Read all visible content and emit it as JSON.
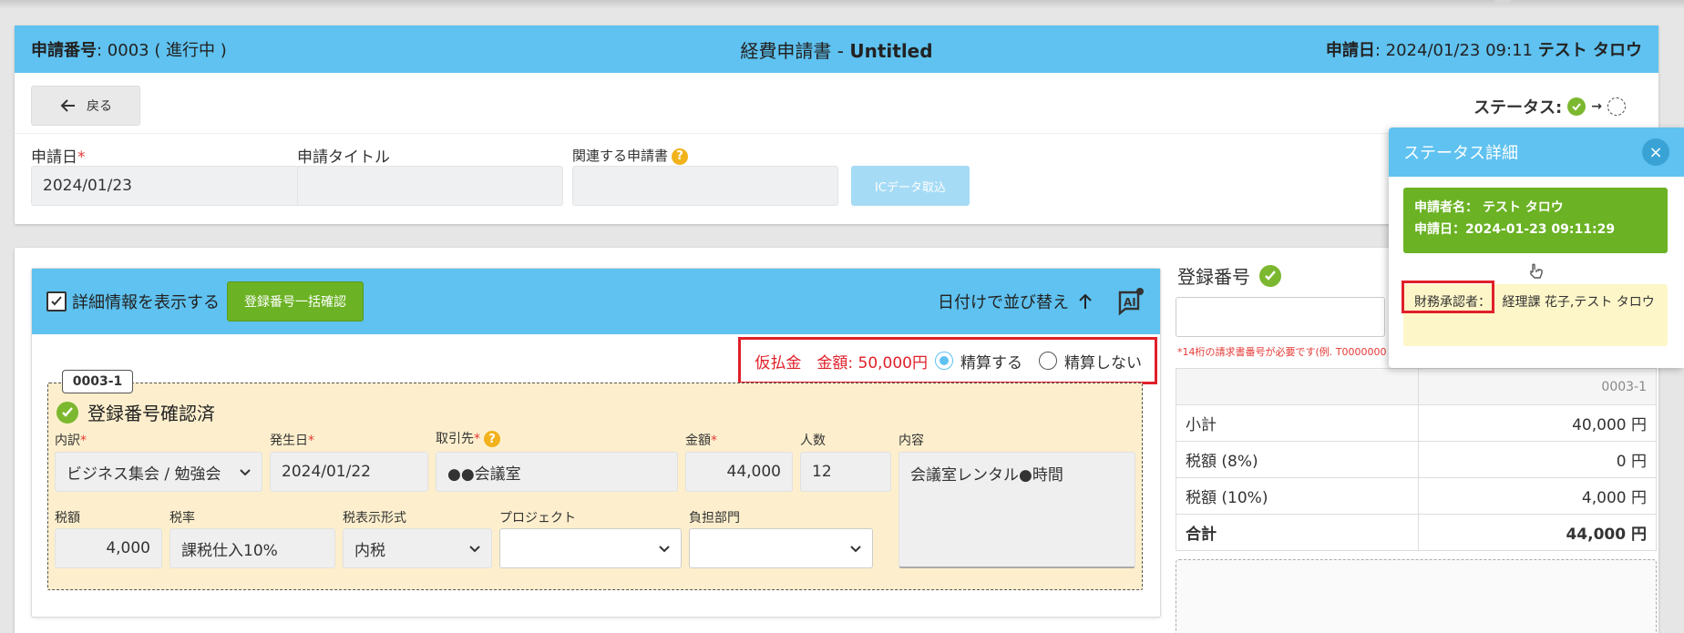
{
  "header": {
    "app_no_label": "申請番号",
    "app_no_value": ": 0003 ( 進行中 )",
    "title_prefix": "経費申請書 - ",
    "title_name": "Untitled",
    "date_label": "申請日",
    "date_value": ": 2024/01/23 09:11",
    "user": "テスト タロウ"
  },
  "toolbar": {
    "back_label": "戻る",
    "status_label": "ステータス:",
    "arrow": "→"
  },
  "form": {
    "date_label": "申請日",
    "required_mark": "*",
    "date_value": "2024/01/23",
    "title_label": "申請タイトル",
    "title_value": "",
    "related_label": "関連する申請書",
    "related_value": "",
    "ic_button": "ICデータ取込"
  },
  "list": {
    "detail_label": "詳細情報を表示する",
    "bulk_button": "登録番号一括確認",
    "sort_label": "日付けで並び替え",
    "advance_label": "仮払金　金額: 50,000円",
    "radio_settle": "精算する",
    "radio_nosettle": "精算しない"
  },
  "entry": {
    "tag": "0003-1",
    "confirmed": "登録番号確認済",
    "breakdown_label": "内訳",
    "breakdown_value": "ビジネス集会 / 勉強会",
    "date_label": "発生日",
    "date_value": "2024/01/22",
    "vendor_label": "取引先",
    "vendor_value": "●●会議室",
    "amount_label": "金額",
    "amount_value": "44,000",
    "people_label": "人数",
    "people_value": "12",
    "content_label": "内容",
    "content_value": "会議室レンタル●時間",
    "tax_label": "税額",
    "tax_value": "4,000",
    "rate_label": "税率",
    "rate_value": "課税仕入10%",
    "taxfmt_label": "税表示形式",
    "taxfmt_value": "内税",
    "project_label": "プロジェクト",
    "project_value": "",
    "dept_label": "負担部門",
    "dept_value": ""
  },
  "summary": {
    "reg_title": "登録番号",
    "reg_hint": "*14桁の請求書番号が必要です(例. T0000000000000)",
    "col_header": "0003-1",
    "rows": [
      {
        "label": "小計",
        "value": "40,000 円"
      },
      {
        "label": "税額 (8%)",
        "value": "0 円"
      },
      {
        "label": "税額 (10%)",
        "value": "4,000 円"
      },
      {
        "label": "合計",
        "value": "44,000 円"
      }
    ]
  },
  "popup": {
    "title": "ステータス詳細",
    "close": "×",
    "applicant_line": "申請者名：  テスト タロウ",
    "date_line": "申請日：2024-01-23 09:11:29",
    "approver_label": "財務承認者：",
    "approver_value": "経理課 花子,テスト タロウ"
  },
  "colors": {
    "header_blue": "#5fc2f0",
    "approved_green": "#6bb224",
    "highlight_red": "#e0202a",
    "pending_yellow": "#fdf6c8"
  }
}
